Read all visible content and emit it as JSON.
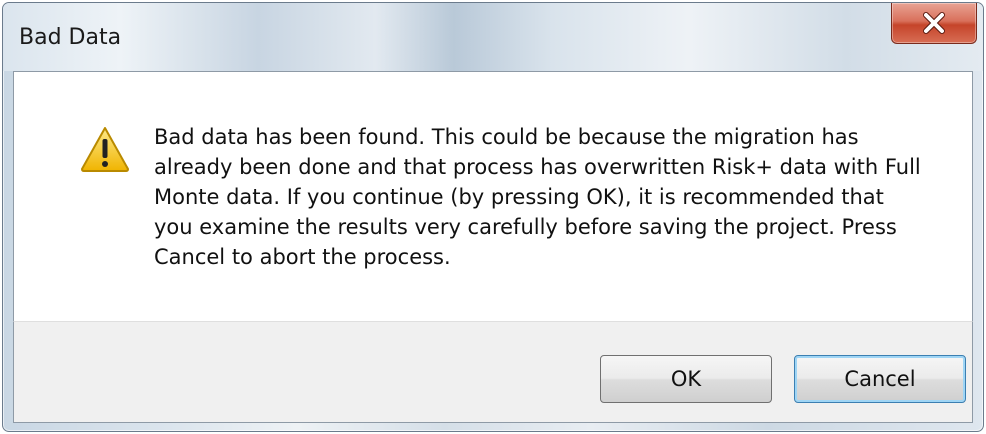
{
  "window": {
    "title": "Bad Data",
    "close_icon": "close-x-icon"
  },
  "message": {
    "icon": "warning-icon",
    "lines": [
      "Bad data has been found.  This could be because the migration has",
      "already been done and that process has overwritten Risk+ data with Full",
      "Monte data.  If you continue (by pressing OK), it is recommended that",
      "you examine the results very carefully before  saving the project.  Press",
      "Cancel to abort the process."
    ]
  },
  "buttons": {
    "ok_label": "OK",
    "cancel_label": "Cancel"
  },
  "colors": {
    "close_button": "#c5442a",
    "warning_fill": "#f4c81b",
    "default_button_border": "#3c7fb1"
  }
}
